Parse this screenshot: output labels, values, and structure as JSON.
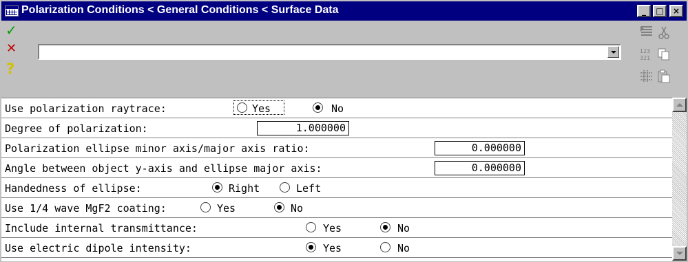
{
  "window": {
    "title": "Polarization Conditions < General Conditions < Surface Data",
    "buttons": {
      "minimize": "_",
      "maximize": "□",
      "close": "×"
    }
  },
  "toolbar": {
    "ok_icon": "✓",
    "cancel_icon": "✕",
    "help_icon": "?",
    "command_value": "",
    "icons": [
      "insert-icon",
      "cut-icon",
      "sort-icon",
      "copy-icon",
      "grid-icon",
      "paste-icon"
    ]
  },
  "rows": [
    {
      "label": "Use polarization raytrace:",
      "options": [
        "Yes",
        "No"
      ],
      "selected": "No",
      "focused": "Yes"
    },
    {
      "label": "Degree of polarization:",
      "value": "1.000000"
    },
    {
      "label": "Polarization ellipse minor axis/major axis ratio:",
      "value": "0.000000"
    },
    {
      "label": "Angle between object y-axis and ellipse major axis:",
      "value": "0.000000"
    },
    {
      "label": "Handedness of ellipse:",
      "options": [
        "Right",
        "Left"
      ],
      "selected": "Right"
    },
    {
      "label": "Use 1/4 wave MgF2 coating:",
      "options": [
        "Yes",
        "No"
      ],
      "selected": "No"
    },
    {
      "label": "Include internal transmittance:",
      "options": [
        "Yes",
        "No"
      ],
      "selected": "No"
    },
    {
      "label": "Use electric dipole intensity:",
      "options": [
        "Yes",
        "No"
      ],
      "selected": "Yes"
    }
  ],
  "colors": {
    "titlebar": "#000080",
    "checkmark": "#00a000",
    "cancel": "#c00000",
    "help": "#d4c000",
    "face": "#c0c0c0"
  }
}
